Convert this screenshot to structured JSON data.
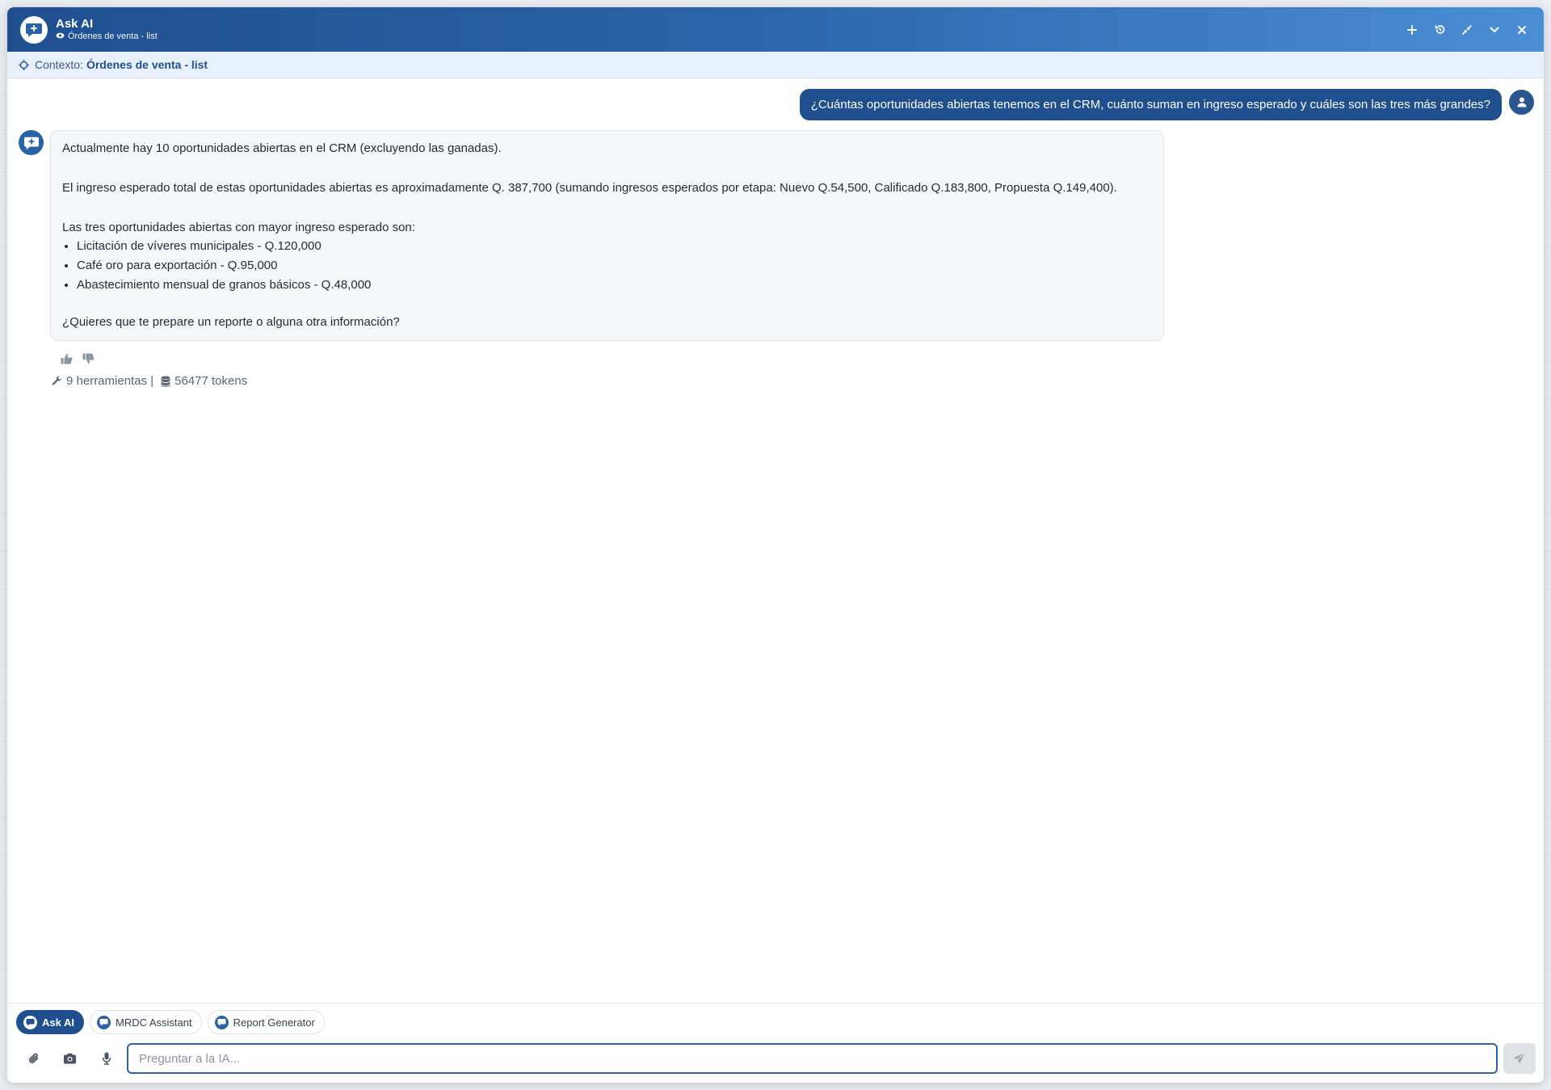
{
  "window": {
    "title": "Ask AI",
    "subtitle": "Órdenes de venta - list"
  },
  "context": {
    "label": "Contexto:",
    "value": "Órdenes de venta - list"
  },
  "conversation": {
    "user_message": "¿Cuántas oportunidades abiertas tenemos en el CRM, cuánto suman en ingreso esperado y cuáles son las tres más grandes?",
    "ai_paragraph_1": "Actualmente hay 10 oportunidades abiertas en el CRM (excluyendo las ganadas).",
    "ai_paragraph_2": "El ingreso esperado total de estas oportunidades abiertas es aproximadamente Q. 387,700 (sumando ingresos esperados por etapa: Nuevo Q.54,500, Calificado Q.183,800, Propuesta Q.149,400).",
    "ai_paragraph_3": "Las tres oportunidades abiertas con mayor ingreso esperado son:",
    "ai_list": [
      "Licitación de víveres municipales - Q.120,000",
      "Café oro para exportación - Q.95,000",
      "Abastecimiento mensual de granos básicos - Q.48,000"
    ],
    "ai_paragraph_4": "¿Quieres que te prepare un reporte o alguna otra información?",
    "meta_tools": "9 herramientas |",
    "meta_tokens": "56477 tokens"
  },
  "agents": [
    {
      "label": "Ask AI",
      "active": true
    },
    {
      "label": "MRDC Assistant",
      "active": false
    },
    {
      "label": "Report Generator",
      "active": false
    }
  ],
  "composer": {
    "placeholder": "Preguntar a la IA..."
  },
  "colors": {
    "brand_dark": "#1f4f8f",
    "brand_light": "#4a8ed6",
    "context_bg": "#e8f1fb"
  },
  "icons": {
    "title_actions": [
      "plus-icon",
      "history-icon",
      "compress-icon",
      "chevron-down-icon",
      "close-icon"
    ],
    "composer_actions": [
      "paperclip-icon",
      "camera-icon",
      "microphone-icon",
      "send-icon"
    ]
  }
}
